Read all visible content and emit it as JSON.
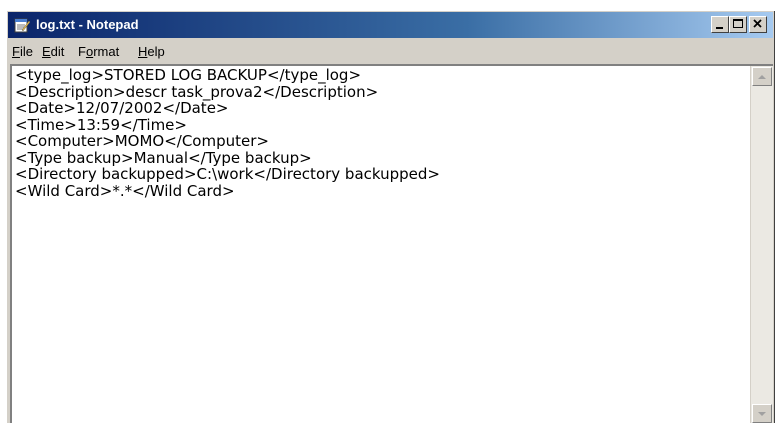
{
  "window": {
    "title": "log.txt - Notepad"
  },
  "menu": [
    {
      "accel": "F",
      "rest": "ile"
    },
    {
      "accel": "E",
      "rest": "dit"
    },
    {
      "pre": "F",
      "accel": "o",
      "rest": "rmat"
    },
    {
      "accel": "H",
      "rest": "elp"
    }
  ],
  "editor": {
    "content": "<type_log>STORED LOG BACKUP</type_log>\n<Description>descr task_prova2</Description>\n<Date>12/07/2002</Date>\n<Time>13:59</Time>\n<Computer>MOMO</Computer>\n<Type backup>Manual</Type backup>\n<Directory backupped>C:\\work</Directory backupped>\n<Wild Card>*.*</Wild Card>"
  },
  "icons": {
    "app": "notepad-icon",
    "minimize": "minimize-icon",
    "maximize": "maximize-icon",
    "close": "close-icon",
    "scroll_up": "arrow-up-icon",
    "scroll_down": "arrow-down-icon"
  },
  "colors": {
    "title_active": "#0a246a",
    "title_gradient_end": "#a6caf0",
    "chrome": "#d4d0c8"
  }
}
